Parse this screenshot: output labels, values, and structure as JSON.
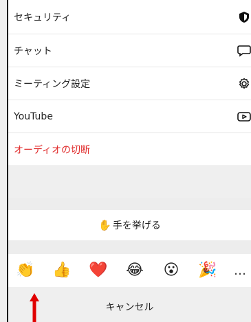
{
  "menu": {
    "items": [
      {
        "label": "セキュリティ",
        "icon": "shield-icon"
      },
      {
        "label": "チャット",
        "icon": "chat-bubble-icon"
      },
      {
        "label": "ミーティング設定",
        "icon": "gear-icon"
      },
      {
        "label": "YouTube",
        "icon": "youtube-icon"
      },
      {
        "label": "オーディオの切断",
        "color": "#e02a2a"
      }
    ]
  },
  "raise_hand": {
    "emoji": "✋",
    "label": "手を挙げる"
  },
  "reactions": {
    "items": [
      "👏",
      "👍",
      "❤️",
      "😂",
      "😮",
      "🎉"
    ],
    "more_label": "…"
  },
  "cancel_label": "キャンセル",
  "colors": {
    "danger": "#e02a2a",
    "annotation_arrow": "#e00000"
  }
}
